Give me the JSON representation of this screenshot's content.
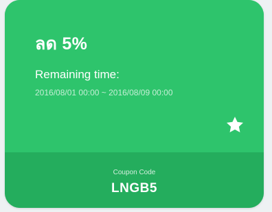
{
  "coupon": {
    "discount_title": "ลด 5%",
    "remaining_label": "Remaining time:",
    "period": "2016/08/01 00:00 ~ 2016/08/09 00:00",
    "code_label": "Coupon Code",
    "code": "LNGB5",
    "favorite_icon": "star-icon"
  },
  "colors": {
    "card_green": "#2ec46c",
    "code_strip_green": "#24ad5d",
    "background": "#eef1f3",
    "text": "#ffffff"
  }
}
